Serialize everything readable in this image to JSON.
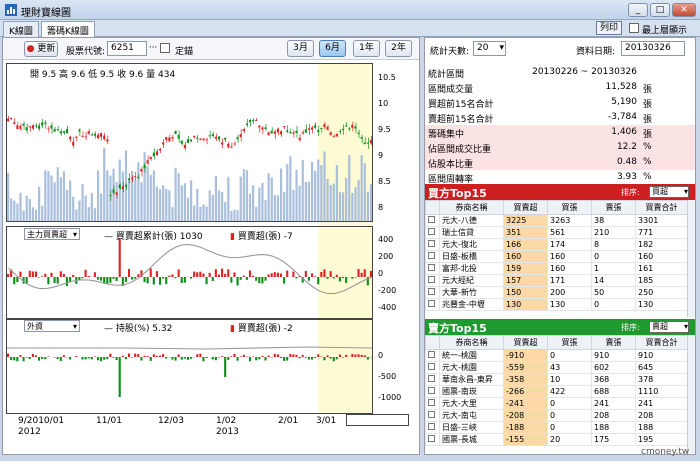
{
  "window": {
    "title": "理財寶線圖",
    "controls": [
      "_",
      "□",
      "✕"
    ]
  },
  "tabs": [
    {
      "label": "K線圖",
      "active": false
    },
    {
      "label": "籌碼K線圖",
      "active": true
    }
  ],
  "header_right": {
    "print_label": "列印",
    "topmost_label": "最上層顯示"
  },
  "toolbar": {
    "refresh_label": "更新",
    "stock_code_label": "股票代號:",
    "stock_code_value": "6251",
    "ellipsis_label": "···",
    "lock_label": "定錨",
    "range_buttons": [
      {
        "label": "3月",
        "selected": false
      },
      {
        "label": "6月",
        "selected": true
      },
      {
        "label": "1年",
        "selected": false
      },
      {
        "label": "2年",
        "selected": false
      }
    ]
  },
  "main_chart": {
    "ohlc_text": "開 9.5  高 9.6  低 9.5  收 9.6  量 434",
    "y_ticks": [
      "10.5",
      "10",
      "9.5",
      "9",
      "8.5",
      "8"
    ]
  },
  "pane2": {
    "selector": "主力買賣超",
    "legend_line": "買賣超累計(張) 1030",
    "legend_bar": "買賣超(張) -7",
    "y_ticks": [
      "400",
      "200",
      "0",
      "-200",
      "-400"
    ]
  },
  "pane3": {
    "selector": "外資",
    "legend_line": "持股(%) 5.32",
    "legend_bar": "買賣超(張) -2",
    "y_ticks": [
      "0",
      "-500",
      "-1000"
    ]
  },
  "x_axis": {
    "ticks": [
      "9/2010/01",
      "11/01",
      "12/03",
      "1/02",
      "2/01",
      "3/01"
    ],
    "years": [
      "2012",
      "2013"
    ]
  },
  "stats_controls": {
    "days_label": "統計天數:",
    "days_value": "20",
    "date_label": "資料日期:",
    "date_value": "20130326"
  },
  "stats": [
    {
      "label": "統計區間",
      "value": "20130226 ~ 20130326",
      "unit": "",
      "pink": false
    },
    {
      "label": "區間成交量",
      "value": "11,528",
      "unit": "張",
      "pink": false
    },
    {
      "label": "買超前15名合計",
      "value": "5,190",
      "unit": "張",
      "pink": false
    },
    {
      "label": "賣超前15名合計",
      "value": "-3,784",
      "unit": "張",
      "pink": false
    },
    {
      "label": "籌碼集中",
      "value": "1,406",
      "unit": "張",
      "pink": true
    },
    {
      "label": "佔區間成交比重",
      "value": "12.2",
      "unit": "%",
      "pink": true
    },
    {
      "label": "佔股本比重",
      "value": "0.48",
      "unit": "%",
      "pink": true
    },
    {
      "label": "區間周轉率",
      "value": "3.93",
      "unit": "%",
      "pink": false
    }
  ],
  "buy_top": {
    "title": "買方Top15",
    "color": "#cc1f1f",
    "sort_label": "排序:",
    "sort_value": "買超",
    "columns": [
      "",
      "券商名稱",
      "買賣超",
      "買張",
      "賣張",
      "買賣合計"
    ],
    "rows": [
      [
        "元大-八德",
        "3225",
        "3263",
        "38",
        "3301"
      ],
      [
        "瑞士信貸",
        "351",
        "561",
        "210",
        "771"
      ],
      [
        "元大-復北",
        "166",
        "174",
        "8",
        "182"
      ],
      [
        "日盛-板橋",
        "160",
        "160",
        "0",
        "160"
      ],
      [
        "富邦-北投",
        "159",
        "160",
        "1",
        "161"
      ],
      [
        "元大經紀",
        "157",
        "171",
        "14",
        "185"
      ],
      [
        "大華-新竹",
        "150",
        "200",
        "50",
        "250"
      ],
      [
        "兆豐金-中壢",
        "130",
        "130",
        "0",
        "130"
      ]
    ]
  },
  "sell_top": {
    "title": "賣方Top15",
    "color": "#1f9a2f",
    "sort_label": "排序:",
    "sort_value": "賣超",
    "columns": [
      "",
      "券商名稱",
      "買賣超",
      "買張",
      "賣張",
      "買賣合計"
    ],
    "rows": [
      [
        "統一-桃園",
        "-910",
        "0",
        "910",
        "910"
      ],
      [
        "元大-桃園",
        "-559",
        "43",
        "602",
        "645"
      ],
      [
        "華南永昌-東昇",
        "-358",
        "10",
        "368",
        "378"
      ],
      [
        "國票-南崁",
        "-266",
        "422",
        "688",
        "1110"
      ],
      [
        "元大-大里",
        "-241",
        "0",
        "241",
        "241"
      ],
      [
        "元大-南屯",
        "-208",
        "0",
        "208",
        "208"
      ],
      [
        "日盛-三峽",
        "-188",
        "0",
        "188",
        "188"
      ],
      [
        "國票-長城",
        "-155",
        "20",
        "175",
        "195"
      ]
    ]
  },
  "watermark": "cmoney.tw",
  "colors": {
    "up": "#e02020",
    "down": "#0a8f1a",
    "volume": "#a9bfdc",
    "highlight": "#fdfbd4"
  }
}
